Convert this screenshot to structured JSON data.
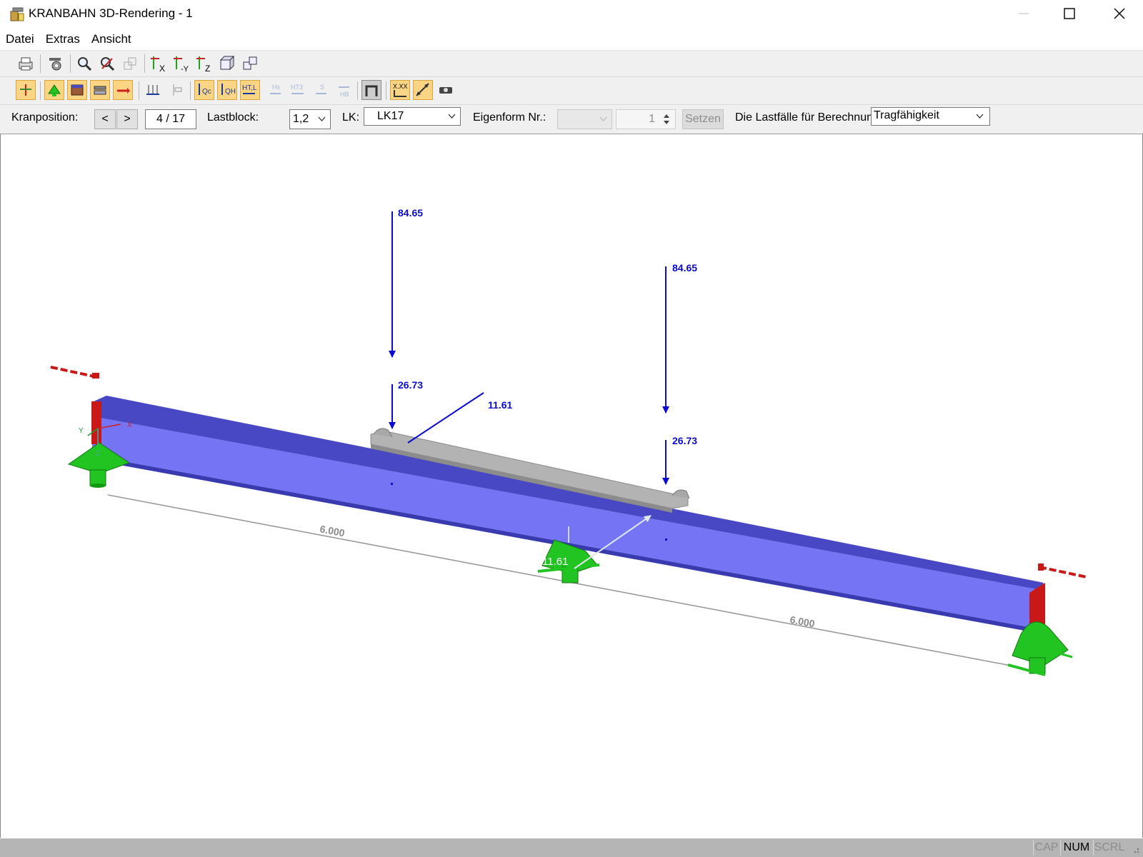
{
  "window": {
    "title": "KRANBAHN 3D-Rendering - 1"
  },
  "menu": [
    "Datei",
    "Extras",
    "Ansicht"
  ],
  "controls": {
    "kranposition_label": "Kranposition:",
    "prev_label": "<",
    "next_label": ">",
    "position_value": "4 / 17",
    "lastblock_label": "Lastblock:",
    "lastblock_value": "1,2",
    "lk_label": "LK:",
    "lk_value": "LK17",
    "eigenform_label": "Eigenform Nr.:",
    "eigenform_spin_value": "1",
    "setzen_label": "Setzen",
    "lastfaelle_label": "Die Lastfälle für Berechnun",
    "lastfaelle_value": "Tragfähigkeit"
  },
  "viewport": {
    "loads": {
      "vertical_upper_1": "84.65",
      "vertical_upper_2": "84.65",
      "vertical_lower_1": "26.73",
      "vertical_lower_2": "26.73",
      "horizontal_1": "11.61",
      "horizontal_2": "11.61"
    },
    "dimensions": {
      "span_1": "6.000",
      "span_2": "6.000"
    },
    "axes": {
      "x": "X",
      "y": "Y",
      "z": "Z"
    }
  },
  "status": {
    "cap": "CAP",
    "num": "NUM",
    "scrl": "SCRL"
  },
  "colors": {
    "beam_front": "#7474f4",
    "beam_top": "#4848c4",
    "load_arrows": "#0a0ad0",
    "supports": "#22c422",
    "end_plates": "#c81818",
    "toolbar_active": "#fbd584"
  }
}
